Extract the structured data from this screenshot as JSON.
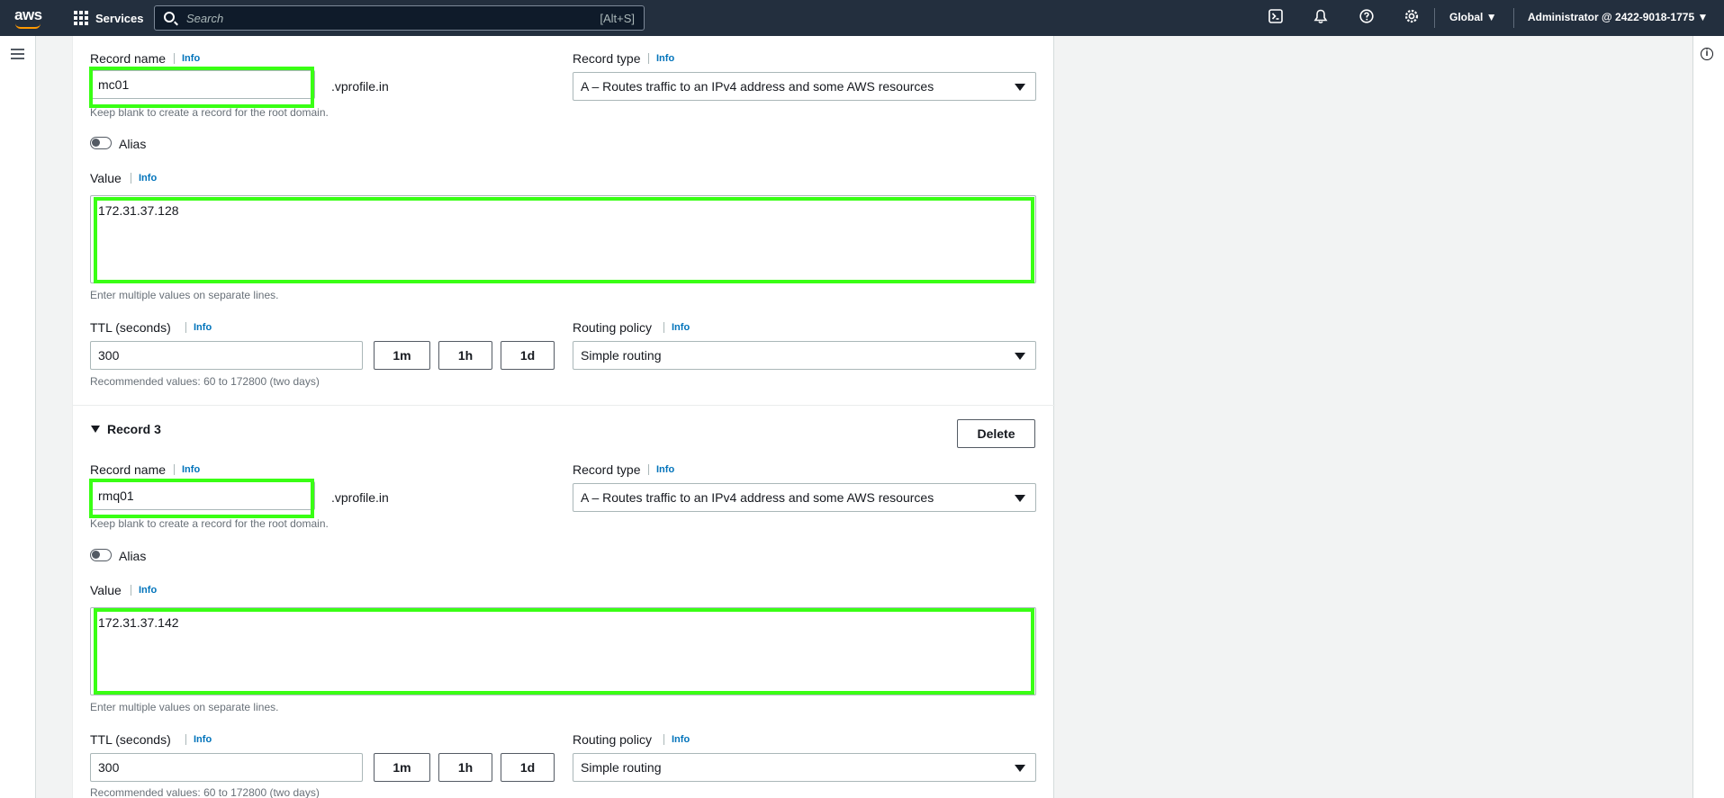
{
  "topnav": {
    "logo": "aws",
    "services_label": "Services",
    "search_placeholder": "Search",
    "search_shortcut": "[Alt+S]",
    "icons": [
      "cloudshell-icon",
      "bell-icon",
      "help-icon",
      "settings-icon"
    ],
    "region": "Global",
    "account": "Administrator @ 2422-9018-1775"
  },
  "colors": {
    "nav_bg": "#232f3e",
    "link": "#0073bb",
    "highlight": "#39ff14"
  },
  "labels": {
    "record_name": "Record name",
    "record_type": "Record type",
    "value": "Value",
    "ttl": "TTL (seconds)",
    "routing_policy": "Routing policy",
    "info": "Info",
    "alias": "Alias",
    "domain_suffix": ".vprofile.in",
    "name_hint": "Keep blank to create a record for the root domain.",
    "value_hint": "Enter multiple values on separate lines.",
    "ttl_hint": "Recommended values: 60 to 172800 (two days)",
    "ttl_1m": "1m",
    "ttl_1h": "1h",
    "ttl_1d": "1d",
    "delete": "Delete"
  },
  "records": [
    {
      "heading": "",
      "name": "mc01",
      "type": "A – Routes traffic to an IPv4 address and some AWS resources",
      "value": "172.31.37.128",
      "ttl": "300",
      "routing": "Simple routing"
    },
    {
      "heading": "Record 3",
      "name": "rmq01",
      "type": "A – Routes traffic to an IPv4 address and some AWS resources",
      "value": "172.31.37.142",
      "ttl": "300",
      "routing": "Simple routing"
    }
  ]
}
